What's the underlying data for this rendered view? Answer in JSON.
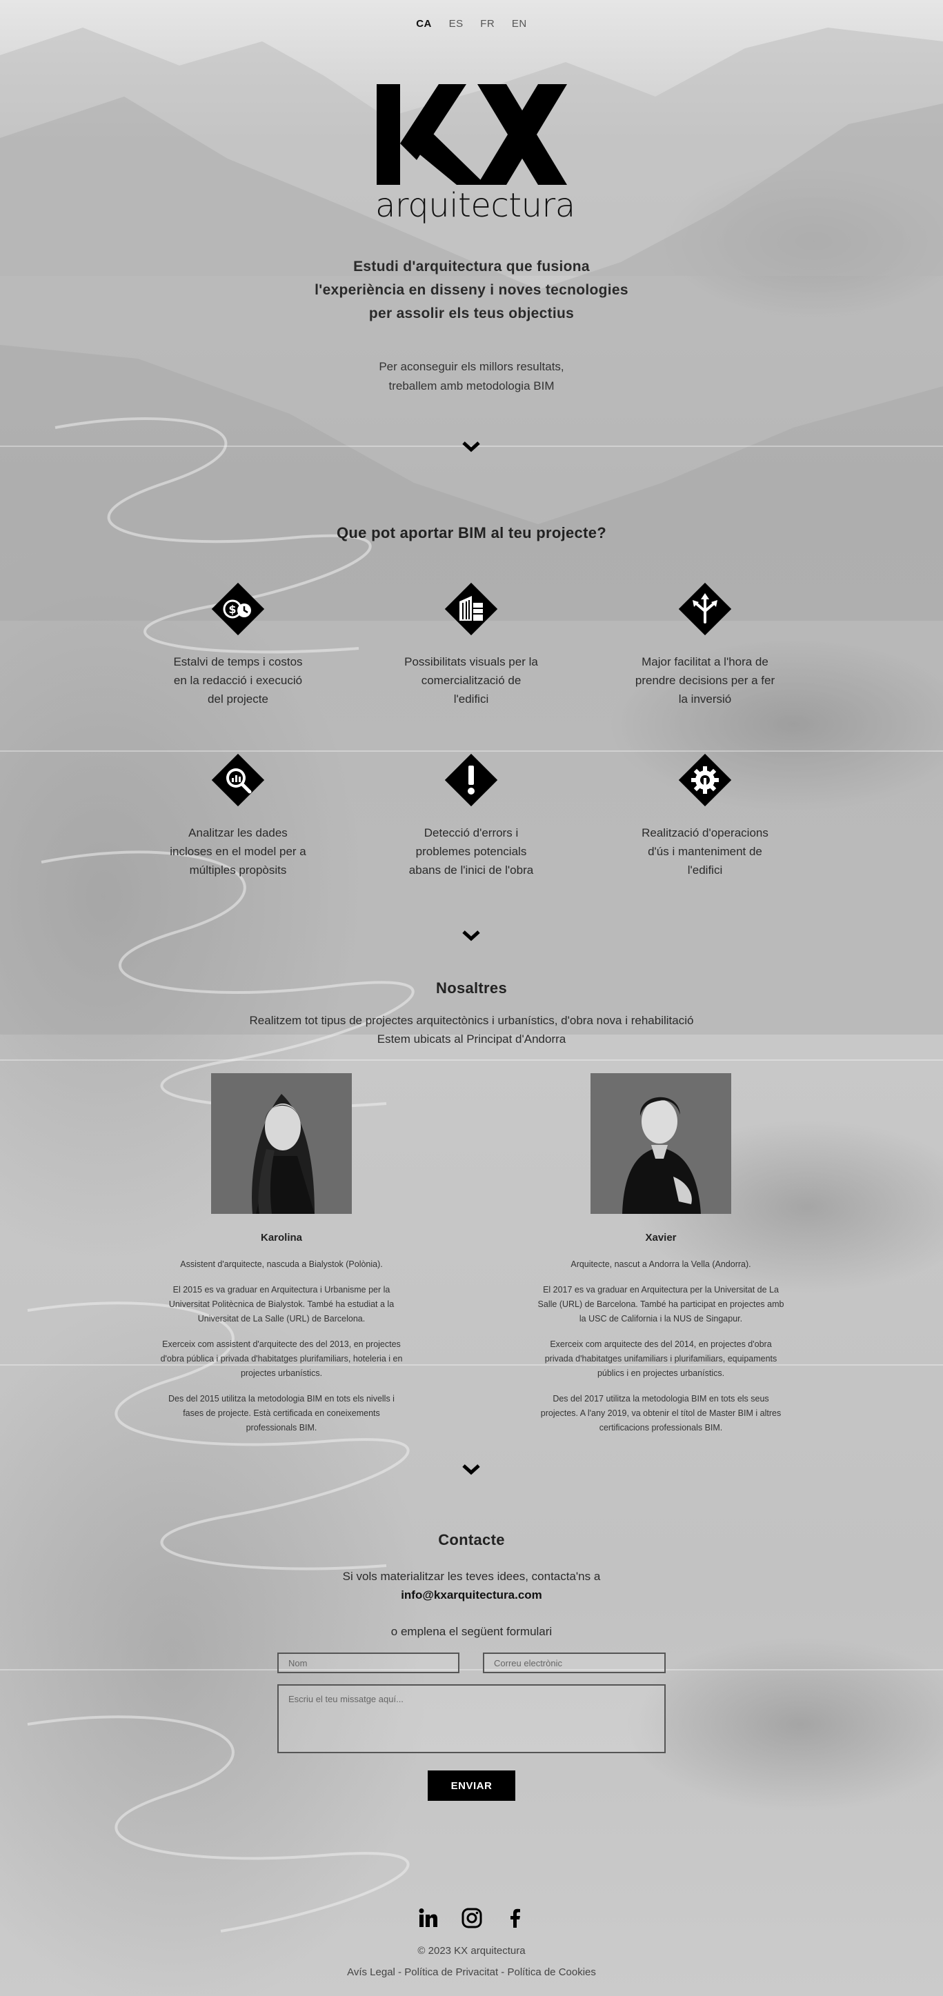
{
  "languages": [
    {
      "code": "CA",
      "active": true
    },
    {
      "code": "ES",
      "active": false
    },
    {
      "code": "FR",
      "active": false
    },
    {
      "code": "EN",
      "active": false
    }
  ],
  "brand": {
    "mark": "KX",
    "word": "arquitectura"
  },
  "hero": {
    "tagline": [
      "Estudi d'arquitectura que fusiona",
      "l'experiència en disseny i noves tecnologies",
      "per assolir els teus objectius"
    ],
    "subline": [
      "Per aconseguir els millors resultats,",
      "treballem amb metodologia BIM"
    ]
  },
  "bim": {
    "title": "Que pot aportar BIM al teu projecte?",
    "features": [
      {
        "icon": "savings-icon",
        "lines": [
          "Estalvi de temps i costos",
          "en la redacció i execució",
          "del projecte"
        ]
      },
      {
        "icon": "building-icon",
        "lines": [
          "Possibilitats visuals per la",
          "comercialització de",
          "l'edifici"
        ]
      },
      {
        "icon": "decision-arrows-icon",
        "lines": [
          "Major facilitat a l'hora de",
          "prendre decisions per a fer",
          "la inversió"
        ]
      },
      {
        "icon": "data-analysis-icon",
        "lines": [
          "Analitzar les dades",
          "incloses en el model per a",
          "múltiples propòsits"
        ]
      },
      {
        "icon": "warning-icon",
        "lines": [
          "Detecció d'errors i",
          "problemes potencials",
          "abans de l'inici de l'obra"
        ]
      },
      {
        "icon": "maintenance-gear-icon",
        "lines": [
          "Realització d'operacions",
          "d'ús i manteniment de",
          "l'edifici"
        ]
      }
    ]
  },
  "about": {
    "title": "Nosaltres",
    "lines": [
      "Realitzem tot tipus de projectes arquitectònics i urbanístics, d'obra nova i rehabilitació",
      "Estem ubicats al Principat d'Andorra"
    ],
    "people": [
      {
        "name": "Karolina",
        "bio": [
          [
            "Assistent d'arquitecte, nascuda a Bialystok (Polònia)."
          ],
          [
            "El 2015 es va graduar en Arquitectura i Urbanisme per la",
            "Universitat Politècnica de Bialystok. També ha estudiat a la",
            "Universitat de La Salle (URL) de Barcelona."
          ],
          [
            "Exerceix com assistent d'arquitecte des del 2013, en projectes",
            "d'obra pública i privada d'habitatges plurifamiliars, hoteleria i en",
            "projectes urbanístics."
          ],
          [
            "Des del 2015 utilitza la metodologia BIM en tots els nivells i",
            "fases de projecte. Està certificada en coneixements",
            "professionals BIM."
          ]
        ]
      },
      {
        "name": "Xavier",
        "bio": [
          [
            "Arquitecte, nascut a Andorra la Vella (Andorra)."
          ],
          [
            "El 2017 es va graduar en Arquitectura per la Universitat de La",
            "Salle (URL) de Barcelona. També ha participat en projectes amb",
            "la USC de California i la NUS de Singapur."
          ],
          [
            "Exerceix com arquitecte des del 2014, en projectes d'obra",
            "privada d'habitatges unifamiliars i plurifamiliars, equipaments",
            "públics i en projectes urbanístics."
          ],
          [
            "Des del 2017 utilitza la metodologia BIM en tots els seus",
            "projectes. A l'any 2019, va obtenir el títol de Master BIM i altres",
            "certificacions professionals BIM."
          ]
        ]
      }
    ]
  },
  "contact": {
    "title": "Contacte",
    "intro": "Si vols materialitzar les teves idees, contacta'ns a",
    "email": "info@kxarquitectura.com",
    "or_text": "o emplena el següent formulari",
    "name_placeholder": "Nom",
    "email_placeholder": "Correu electrònic",
    "message_placeholder": "Escriu el teu missatge aquí...",
    "send_label": "ENVIAR"
  },
  "footer": {
    "social": [
      "linkedin-icon",
      "instagram-icon",
      "facebook-icon"
    ],
    "copyright": "© 2023 KX arquitectura",
    "links": [
      "Avís Legal",
      "Política de Privacitat",
      "Política de Cookies"
    ],
    "separator": " - "
  }
}
